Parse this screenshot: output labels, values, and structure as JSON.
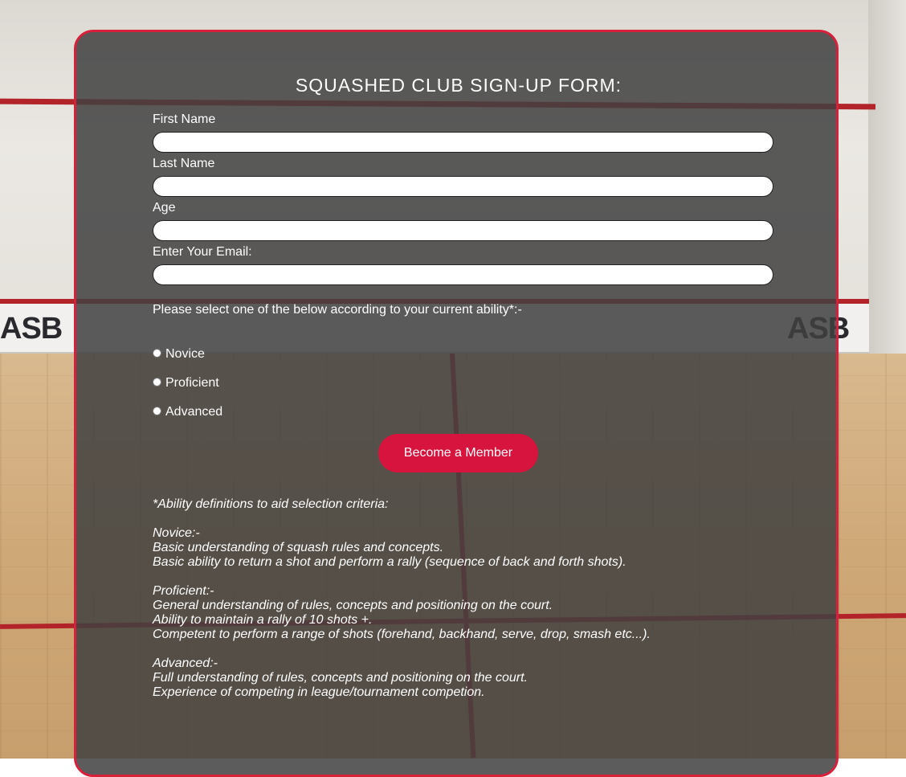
{
  "form": {
    "title": "SQUASHED CLUB SIGN-UP FORM:",
    "fields": [
      {
        "label": "First Name",
        "value": ""
      },
      {
        "label": "Last Name",
        "value": ""
      },
      {
        "label": "Age",
        "value": ""
      },
      {
        "label": "Enter Your Email:",
        "value": ""
      }
    ],
    "ability_prompt": "Please select one of the below according to your current ability*:-",
    "abilities": [
      "Novice",
      "Proficient",
      "Advanced"
    ],
    "submit_label": "Become a Member"
  },
  "definitions": {
    "heading": "*Ability definitions to aid selection criteria:",
    "novice": {
      "title": "Novice:-",
      "lines": [
        "Basic understanding of squash rules and concepts.",
        "Basic ability to return a shot and perform a rally (sequence of back and forth shots)."
      ]
    },
    "proficient": {
      "title": "Proficient:-",
      "lines": [
        "General understanding of rules, concepts and positioning on the court.",
        "Ability to maintain a rally of 10 shots +.",
        "Competent to perform a range of shots (forehand, backhand, serve, drop, smash etc...)."
      ]
    },
    "advanced": {
      "title": "Advanced:-",
      "lines": [
        "Full understanding of rules, concepts and positioning on the court.",
        "Experience of competing in league/tournament competion."
      ]
    }
  },
  "background": {
    "logo_text": "ASB"
  },
  "colors": {
    "accent": "#d6143d",
    "panel_border": "#d6203c",
    "panel_bg": "#404040"
  }
}
